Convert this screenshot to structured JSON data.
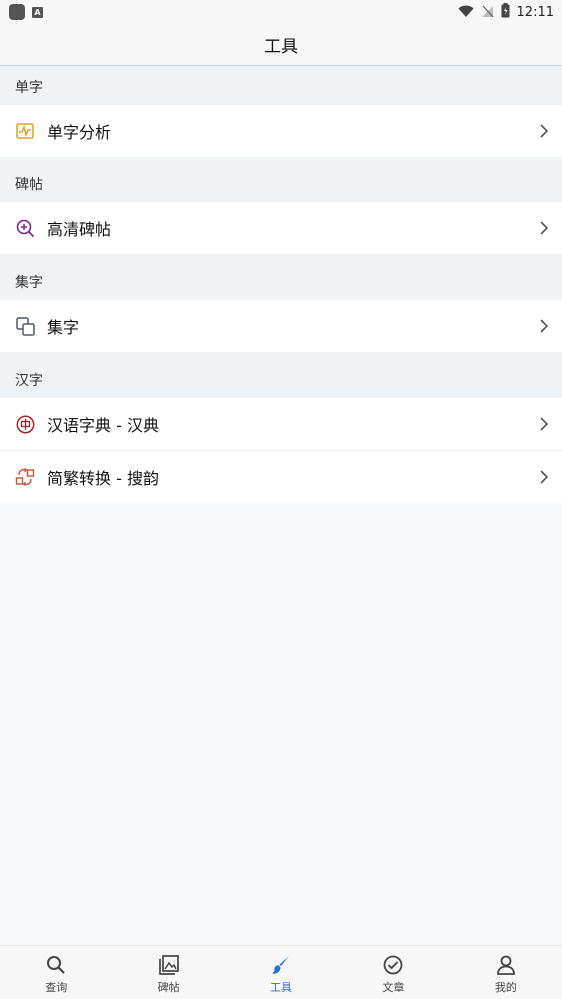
{
  "status_bar": {
    "time": "12:11"
  },
  "header": {
    "title": "工具"
  },
  "sections": [
    {
      "title": "单字",
      "items": [
        {
          "label": "单字分析",
          "icon": "chart-icon"
        }
      ]
    },
    {
      "title": "碑帖",
      "items": [
        {
          "label": "高清碑帖",
          "icon": "zoom-in-icon"
        }
      ]
    },
    {
      "title": "集字",
      "items": [
        {
          "label": "集字",
          "icon": "copy-icon"
        }
      ]
    },
    {
      "title": "汉字",
      "items": [
        {
          "label": "汉语字典 - 汉典",
          "icon": "zhong-seal-icon"
        },
        {
          "label": "简繁转换 - 搜韵",
          "icon": "convert-icon"
        }
      ]
    }
  ],
  "bottom_nav": [
    {
      "label": "查询",
      "icon": "search-icon"
    },
    {
      "label": "碑帖",
      "icon": "gallery-icon"
    },
    {
      "label": "工具",
      "icon": "brush-icon",
      "active": true
    },
    {
      "label": "文章",
      "icon": "check-circle-icon"
    },
    {
      "label": "我的",
      "icon": "user-icon"
    }
  ],
  "colors": {
    "accent": "#2f6fd1",
    "icon_orange": "#d9a321",
    "icon_purple": "#7a2a8a",
    "icon_red": "#9b2b2b",
    "background": "#f6f8fa"
  }
}
